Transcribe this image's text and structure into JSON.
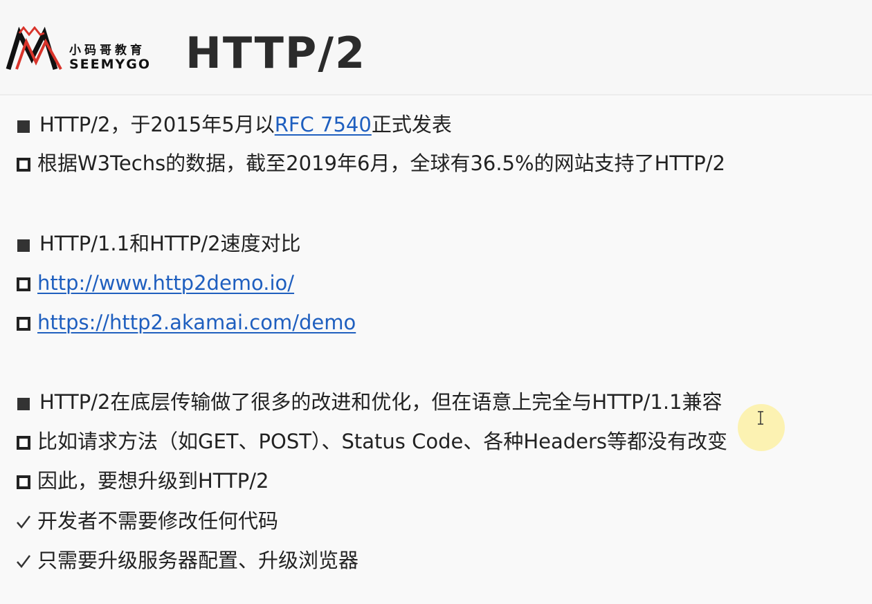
{
  "header": {
    "logo_cn": "小码哥教育",
    "logo_en": "SEEMYGO",
    "title": "HTTP/2"
  },
  "lines": [
    {
      "marker": "filled-square-icon",
      "before": "HTTP/2，于2015年5月以",
      "link": "RFC 7540",
      "after": "正式发表"
    },
    {
      "marker": "hollow-square-icon",
      "text": "根据W3Techs的数据，截至2019年6月，全球有36.5%的网站支持了HTTP/2"
    },
    {
      "marker": "filled-square-icon",
      "text": "HTTP/1.1和HTTP/2速度对比"
    },
    {
      "marker": "hollow-square-icon",
      "link": "http://www.http2demo.io/"
    },
    {
      "marker": "hollow-square-icon",
      "link": "https://http2.akamai.com/demo"
    },
    {
      "marker": "filled-square-icon",
      "text": "HTTP/2在底层传输做了很多的改进和优化，但在语意上完全与HTTP/1.1兼容"
    },
    {
      "marker": "hollow-square-icon",
      "text": "比如请求方法（如GET、POST）、Status Code、各种Headers等都没有改变"
    },
    {
      "marker": "hollow-square-icon",
      "text": "因此，要想升级到HTTP/2"
    },
    {
      "marker": "check-icon",
      "text": "开发者不需要修改任何代码"
    },
    {
      "marker": "check-icon",
      "text": "只需要升级服务器配置、升级浏览器"
    }
  ],
  "colors": {
    "link": "#1f5fbf",
    "logo_red": "#d9342b",
    "text": "#222222"
  }
}
